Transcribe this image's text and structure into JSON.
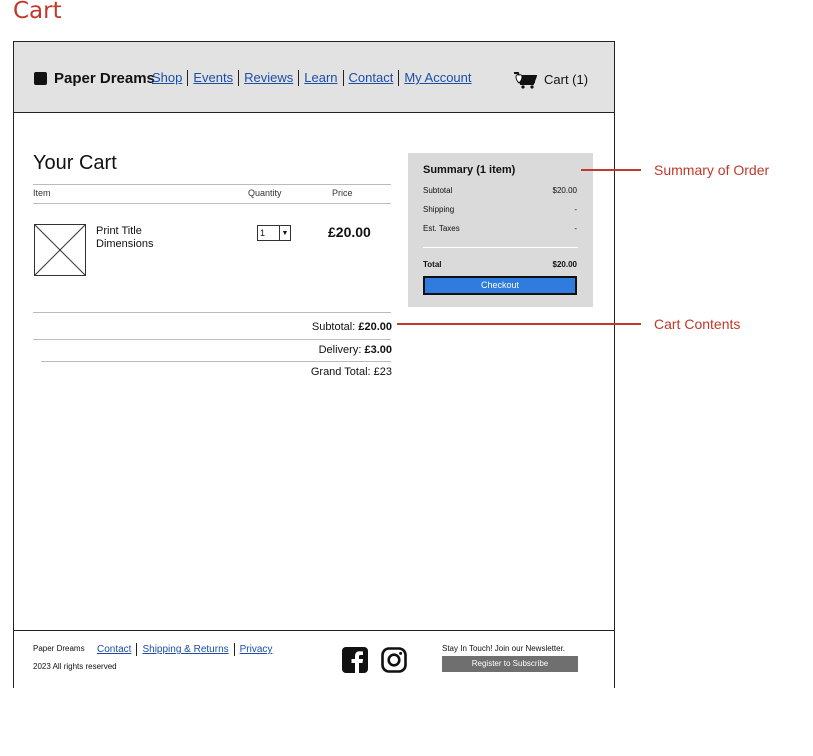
{
  "page_title": "Cart",
  "header": {
    "brand": "Paper Dreams",
    "nav": [
      "Shop",
      "Events",
      "Reviews",
      "Learn",
      "Contact",
      "My Account"
    ],
    "cart_label": "Cart (1)",
    "cart_icon": "cart-icon"
  },
  "cart": {
    "heading": "Your Cart",
    "columns": {
      "item": "Item",
      "quantity": "Quantity",
      "price": "Price"
    },
    "items": [
      {
        "name": "Print Title",
        "detail": "Dimensions",
        "quantity": "1",
        "price": "£20.00"
      }
    ],
    "subtotal_label": "Subtotal:",
    "subtotal_value": "£20.00",
    "delivery_label": "Delivery:",
    "delivery_value": "£3.00",
    "grand_total_label": "Grand Total:",
    "grand_total_value": "£23"
  },
  "summary": {
    "title": "Summary (1 item)",
    "subtotal_label": "Subtotal",
    "subtotal_value": "$20.00",
    "shipping_label": "Shipping",
    "shipping_value": "-",
    "taxes_label": "Est. Taxes",
    "taxes_value": "-",
    "total_label": "Total",
    "total_value": "$20.00",
    "checkout_label": "Checkout"
  },
  "footer": {
    "brand": "Paper Dreams",
    "copyright": "2023 All rights reserved",
    "links": [
      "Contact",
      "Shipping & Returns",
      "Privacy"
    ],
    "newsletter_text": "Stay In Touch! Join our Newsletter.",
    "subscribe_label": "Register to Subscribe"
  },
  "annotations": {
    "summary": "Summary of Order",
    "contents": "Cart Contents"
  },
  "colors": {
    "annotation": "#c0392b",
    "link": "#1b4ea8",
    "checkout": "#2f7bde"
  }
}
